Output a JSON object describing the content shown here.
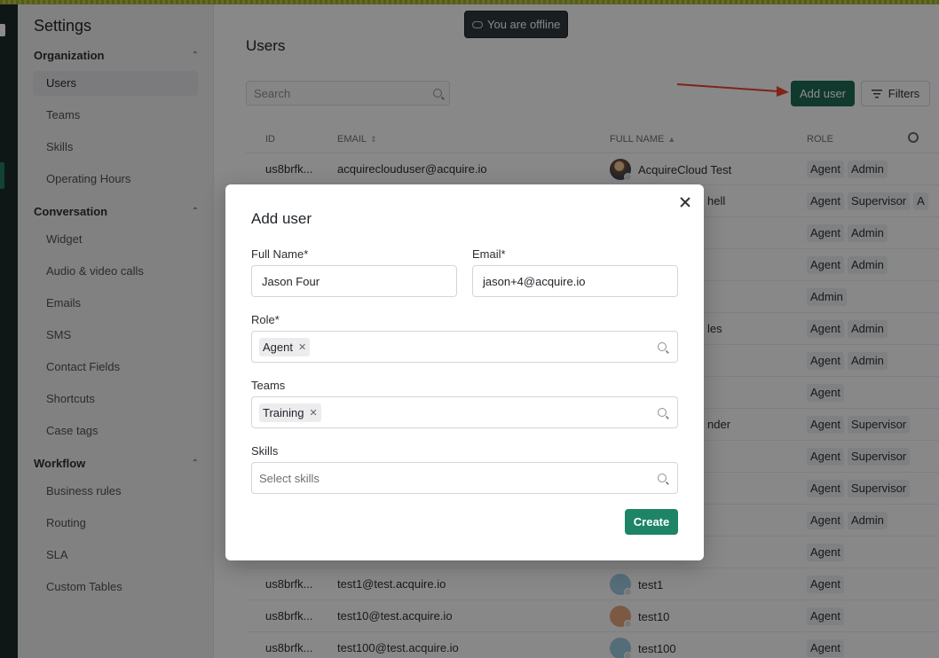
{
  "offline_banner": "You are offline",
  "sidebar": {
    "title": "Settings",
    "sections": [
      {
        "label": "Organization",
        "items": [
          "Users",
          "Teams",
          "Skills",
          "Operating Hours"
        ]
      },
      {
        "label": "Conversation",
        "items": [
          "Widget",
          "Audio & video calls",
          "Emails",
          "SMS",
          "Contact Fields",
          "Shortcuts",
          "Case tags"
        ]
      },
      {
        "label": "Workflow",
        "items": [
          "Business rules",
          "Routing",
          "SLA",
          "Custom Tables"
        ]
      }
    ],
    "active_item": "Users"
  },
  "main": {
    "title": "Users",
    "search_placeholder": "Search",
    "add_user_label": "Add user",
    "filters_label": "Filters",
    "columns": {
      "id": "ID",
      "email": "EMAIL",
      "full_name": "FULL NAME",
      "role": "ROLE"
    },
    "rows": [
      {
        "id": "us8brfk...",
        "email": "acquireclouduser@acquire.io",
        "name": "AcquireCloud Test",
        "roles": [
          "Agent",
          "Admin"
        ]
      },
      {
        "name_fragment": "hell",
        "roles": [
          "Agent",
          "Supervisor",
          "A"
        ]
      },
      {
        "roles": [
          "Agent",
          "Admin"
        ]
      },
      {
        "roles": [
          "Agent",
          "Admin"
        ]
      },
      {
        "roles": [
          "Admin"
        ]
      },
      {
        "name_fragment": "les",
        "roles": [
          "Agent",
          "Admin"
        ]
      },
      {
        "roles": [
          "Agent",
          "Admin"
        ]
      },
      {
        "roles": [
          "Agent"
        ]
      },
      {
        "name_fragment": "nder",
        "roles": [
          "Agent",
          "Supervisor"
        ]
      },
      {
        "roles": [
          "Agent",
          "Supervisor"
        ]
      },
      {
        "roles": [
          "Agent",
          "Supervisor"
        ]
      },
      {
        "roles": [
          "Agent",
          "Admin"
        ]
      },
      {
        "roles": [
          "Agent"
        ]
      },
      {
        "id": "us8brfk...",
        "email": "test1@test.acquire.io",
        "name": "test1",
        "roles": [
          "Agent"
        ]
      },
      {
        "id": "us8brfk...",
        "email": "test10@test.acquire.io",
        "name": "test10",
        "roles": [
          "Agent"
        ]
      },
      {
        "id": "us8brfk...",
        "email": "test100@test.acquire.io",
        "name": "test100",
        "roles": [
          "Agent"
        ]
      }
    ]
  },
  "modal": {
    "title": "Add user",
    "full_name_label": "Full Name*",
    "full_name_value": "Jason Four",
    "email_label": "Email*",
    "email_value": "jason+4@acquire.io",
    "role_label": "Role*",
    "role_chip": "Agent",
    "teams_label": "Teams",
    "teams_chip": "Training",
    "skills_label": "Skills",
    "skills_placeholder": "Select skills",
    "create_label": "Create"
  },
  "colors": {
    "primary": "#1d6b53",
    "create": "#1d8466",
    "annotation_arrow": "#e8432a"
  }
}
